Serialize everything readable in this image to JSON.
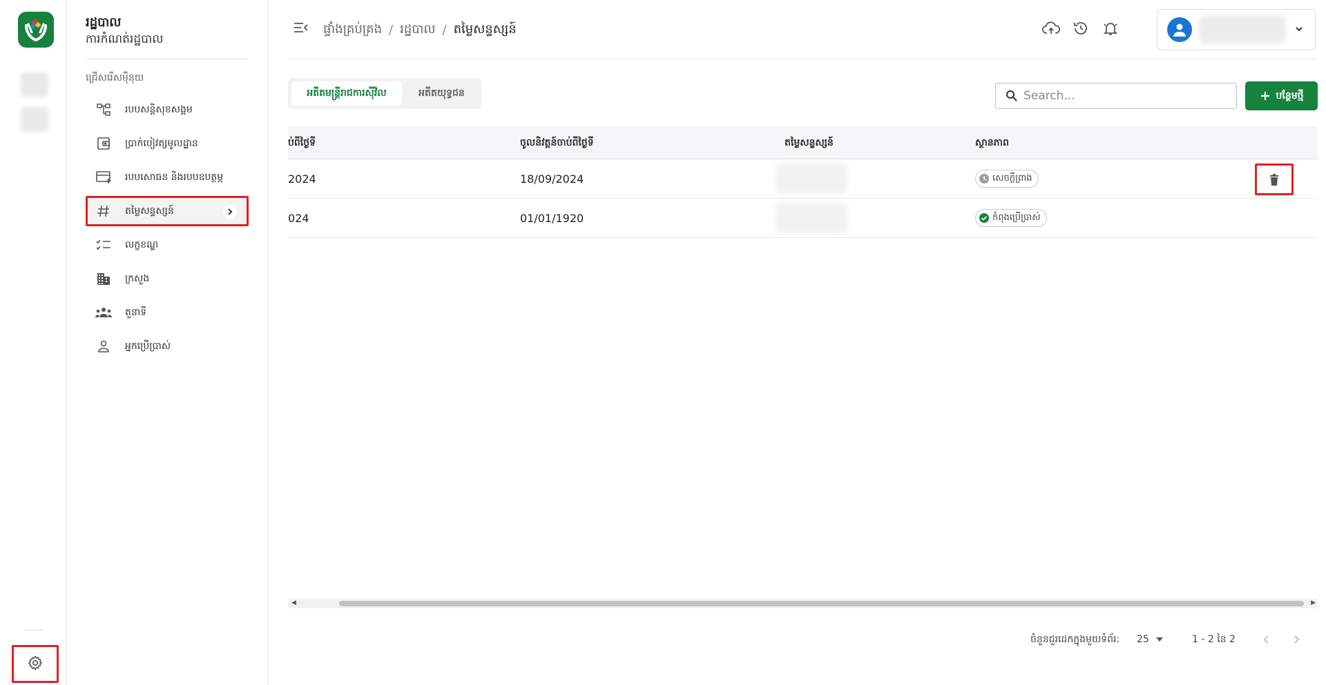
{
  "sidenav": {
    "title": "រដ្ឋបាល",
    "subtitle": "ការកំណត់រដ្ឋបាល",
    "section_label": "ជ្រើសរើសម៉ឺនុយ",
    "items": [
      {
        "label": "របបសន្តិសុខសង្គម",
        "icon": "hierarchy-icon"
      },
      {
        "label": "ប្រាក់បៀវត្សមូលដ្ឋាន",
        "icon": "wallet-icon"
      },
      {
        "label": "របបសោធន និងរបបឧបត្ថម្ភ",
        "icon": "card-add-icon"
      },
      {
        "label": "តម្លៃសន្ទស្សន៍",
        "icon": "hash-icon",
        "active": true
      },
      {
        "label": "លក្ខខណ្ឌ",
        "icon": "checklist-icon"
      },
      {
        "label": "ក្រសួង",
        "icon": "building-icon"
      },
      {
        "label": "តួនាទី",
        "icon": "group-icon"
      },
      {
        "label": "អ្នកប្រើប្រាស់",
        "icon": "person-icon"
      }
    ]
  },
  "header": {
    "breadcrumb": [
      "ផ្ទាំងគ្រប់គ្រង",
      "រដ្ឋបាល",
      "តម្លៃសន្ទស្សន៍"
    ],
    "separator": "/",
    "icons": [
      "cloud-upload-icon",
      "history-icon",
      "bell-off-icon"
    ]
  },
  "toolbar": {
    "tabs": [
      {
        "label": "អតីតមន្ត្រីរាជការស៊ីវិល",
        "active": true
      },
      {
        "label": "អតីតយុទ្ធជន",
        "active": false
      }
    ],
    "search_placeholder": "Search...",
    "add_label": "បន្ថែមថ្មី"
  },
  "table": {
    "columns": [
      "ប់ពីថ្ងៃទី",
      "ចូលនិវត្តន៍ចាប់ពីថ្ងៃទី",
      "តម្លៃសន្ទស្សន៍",
      "ស្ថានភាព"
    ],
    "rows": [
      {
        "date_from": "2024",
        "retire_from": "18/09/2024",
        "status": "សេចក្ដីព្រាង",
        "status_type": "draft",
        "has_delete": true
      },
      {
        "date_from": "024",
        "retire_from": "01/01/1920",
        "status": "កំពុងប្រើប្រាស់",
        "status_type": "active",
        "has_delete": false
      }
    ]
  },
  "pager": {
    "rows_per_page_label": "ចំនួនជួរដេកក្នុងមួយទំព័រ:",
    "rows_per_page": "25",
    "range": "1 - 2 នៃ 2"
  },
  "colors": {
    "brand_green": "#16823e",
    "highlight_red": "#e02020",
    "avatar_blue": "#1976d2"
  }
}
